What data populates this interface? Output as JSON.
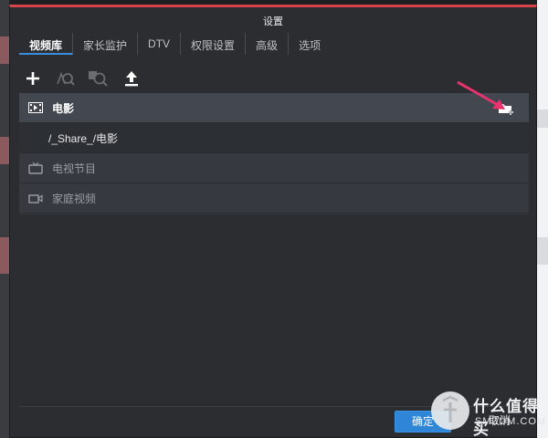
{
  "dialog": {
    "title": "设置",
    "accent_color": "#d74449"
  },
  "tabs": [
    {
      "label": "视频库",
      "active": true
    },
    {
      "label": "家长监护",
      "active": false
    },
    {
      "label": "DTV",
      "active": false
    },
    {
      "label": "权限设置",
      "active": false
    },
    {
      "label": "高级",
      "active": false
    },
    {
      "label": "选项",
      "active": false
    }
  ],
  "toolbar": {
    "items": [
      {
        "icon": "plus-icon",
        "enabled": true
      },
      {
        "icon": "search-edit-icon",
        "enabled": false
      },
      {
        "icon": "search-library-icon",
        "enabled": false
      },
      {
        "icon": "upload-icon",
        "enabled": true
      }
    ]
  },
  "library": {
    "rows": [
      {
        "icon": "film-icon",
        "label": "电影",
        "selected": true
      },
      {
        "icon": "",
        "label": "/_Share_/电影",
        "sub": true
      },
      {
        "icon": "tv-icon",
        "label": "电视节目"
      },
      {
        "icon": "video-camera-icon",
        "label": "家庭视频"
      }
    ],
    "add_folder_icon": "add-folder-icon"
  },
  "annotation": {
    "arrow_color": "#e8336d"
  },
  "footer": {
    "ok_label": "确定",
    "cancel_label": "取消",
    "ok_color": "#2f86d6"
  },
  "watermark": {
    "cn": "什么值得买",
    "en": "SMZDM.COM"
  }
}
